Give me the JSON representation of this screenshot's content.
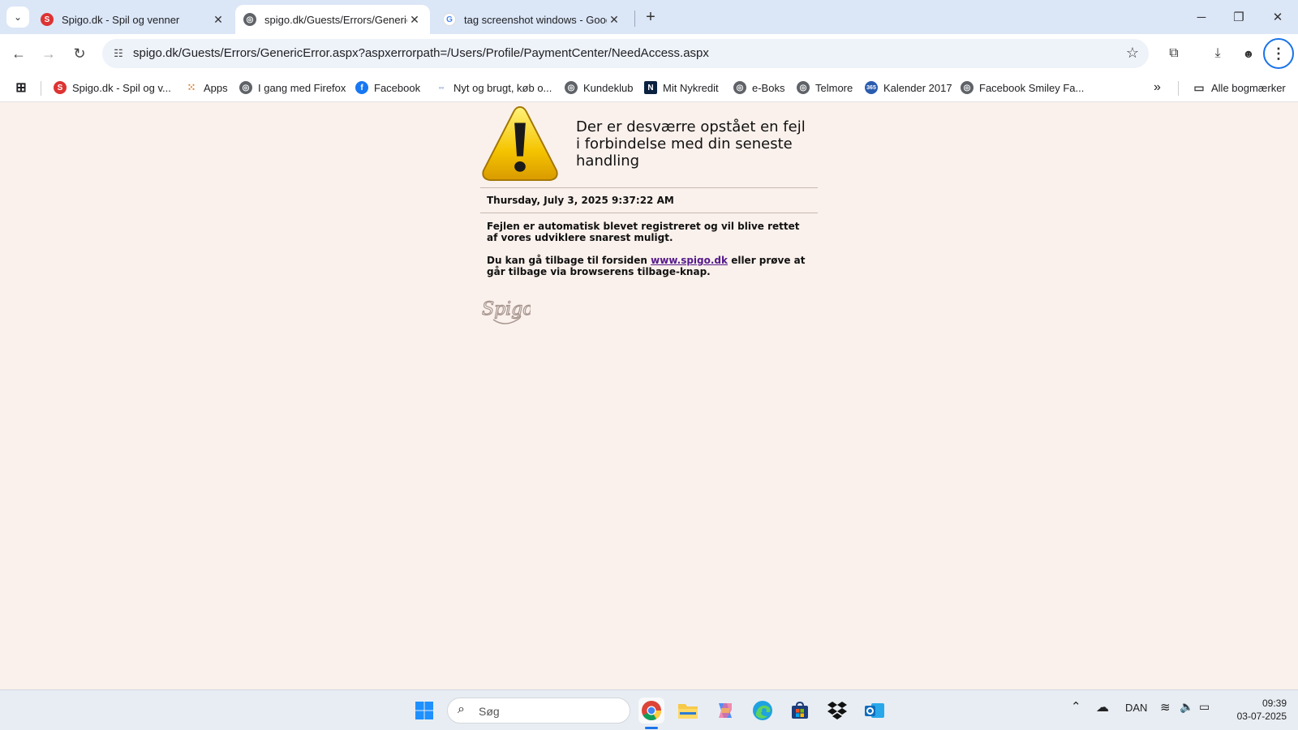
{
  "tabs": [
    {
      "title": "Spigo.dk - Spil og venner",
      "close": "✕"
    },
    {
      "title": "spigo.dk/Guests/Errors/GenericError.aspx",
      "close": "✕"
    },
    {
      "title": "tag screenshot windows - Google Søgning",
      "close": "✕"
    }
  ],
  "toolbar": {
    "url": "spigo.dk/Guests/Errors/GenericError.aspx?aspxerrorpath=/Users/Profile/PaymentCenter/NeedAccess.aspx"
  },
  "bookmarks": [
    {
      "label": "Spigo.dk - Spil og v...",
      "icon": "spigo-icon"
    },
    {
      "label": "Apps",
      "icon": "apps-grid-icon"
    },
    {
      "label": "I gang med Firefox",
      "icon": "globe-icon"
    },
    {
      "label": "Facebook",
      "icon": "facebook-icon"
    },
    {
      "label": "Nyt og brugt, køb o...",
      "icon": "dba-icon"
    },
    {
      "label": "Kundeklub",
      "icon": "globe-icon"
    },
    {
      "label": "Mit Nykredit",
      "icon": "nykredit-icon"
    },
    {
      "label": "e-Boks",
      "icon": "globe-icon"
    },
    {
      "label": "Telmore",
      "icon": "globe-icon"
    },
    {
      "label": "Kalender 2017",
      "icon": "calendar-365-icon"
    },
    {
      "label": "Facebook Smiley Fa...",
      "icon": "globe-icon"
    }
  ],
  "bookmarks_more": "»",
  "all_bookmarks": "Alle bogmærker",
  "page": {
    "heading": "Der er desværre opstået en fejl i forbindelse med din seneste handling",
    "date": "Thursday, July 3, 2025 9:37:22 AM",
    "message": "Fejlen er automatisk blevet registreret og vil blive rettet af vores udviklere snarest muligt.",
    "back_prefix": "Du kan gå tilbage til forsiden",
    "back_link": "www.spigo.dk",
    "back_suffix": "eller prøve at går tilbage via browserens tilbage-knap."
  },
  "taskbar": {
    "search_placeholder": "Søg",
    "language": "DAN",
    "time": "09:39",
    "date": "03-07-2025"
  },
  "colors": {
    "page_bg": "#faf1ec",
    "tabstrip_bg": "#dbe6f7",
    "link": "#551a8b",
    "warning_yellow": "#f5c400",
    "focus_ring": "#1a73e8"
  }
}
